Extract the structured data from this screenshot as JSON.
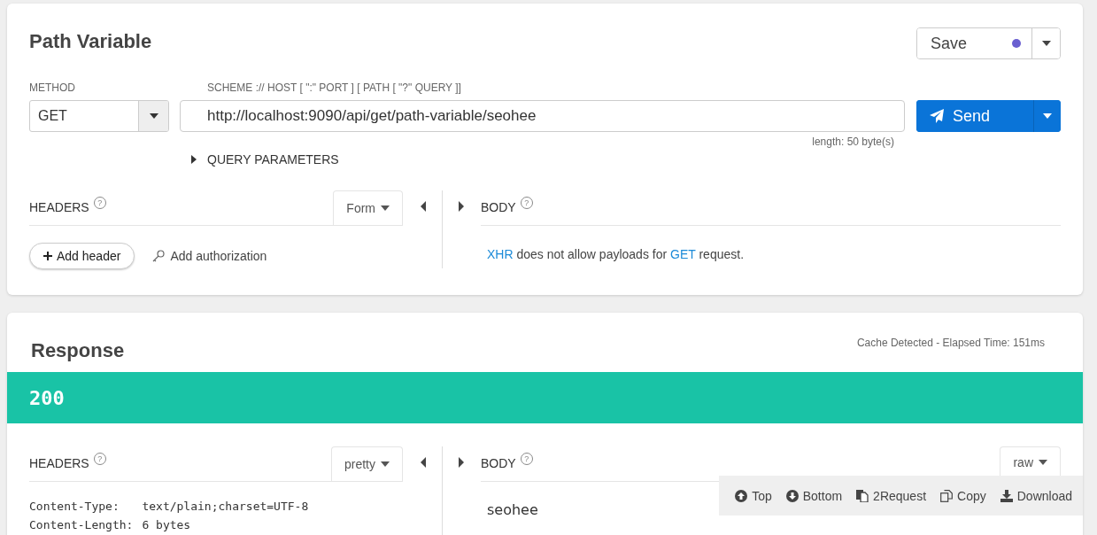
{
  "request": {
    "title": "Path Variable",
    "save": {
      "label": "Save",
      "modified": true
    },
    "method": {
      "label": "METHOD",
      "value": "GET"
    },
    "url": {
      "label": "SCHEME :// HOST [ \":\" PORT ] [ PATH [ \"?\" QUERY ]]",
      "value": "http://localhost:9090/api/get/path-variable/seohee",
      "length": "length: 50 byte(s)"
    },
    "send": "Send",
    "query_parameters": {
      "label": "QUERY PARAMETERS",
      "expanded": false
    },
    "headers": {
      "label": "HEADERS",
      "help": "?",
      "format": "Form"
    },
    "actions": [
      {
        "kind": "add",
        "label": "Add header"
      },
      {
        "kind": "auth",
        "label": "Add authorization"
      }
    ],
    "body": {
      "label": "BODY",
      "help": "?",
      "message": [
        {
          "kind": "link",
          "text": "XHR"
        },
        {
          "kind": "text",
          "text": " does not allow payloads for "
        },
        {
          "kind": "link",
          "text": "GET"
        },
        {
          "kind": "text",
          "text": " request."
        }
      ]
    }
  },
  "response": {
    "title": "Response",
    "timing": "Cache Detected - Elapsed Time: 151ms",
    "status": "200",
    "headers": {
      "label": "HEADERS",
      "help": "?",
      "format": "pretty",
      "lines": [
        {
          "name": "Content-Type:",
          "value": "text/plain;charset=UTF-8"
        },
        {
          "name": "Content-Length:",
          "value": "6 bytes"
        }
      ]
    },
    "body": {
      "label": "BODY",
      "help": "?",
      "format": "raw",
      "content": "seohee"
    },
    "toolbar": [
      {
        "kind": "up",
        "label": "Top"
      },
      {
        "kind": "down",
        "label": "Bottom"
      },
      {
        "kind": "docs",
        "label": "2Request"
      },
      {
        "kind": "copy",
        "label": "Copy"
      },
      {
        "kind": "download",
        "label": "Download"
      }
    ]
  }
}
